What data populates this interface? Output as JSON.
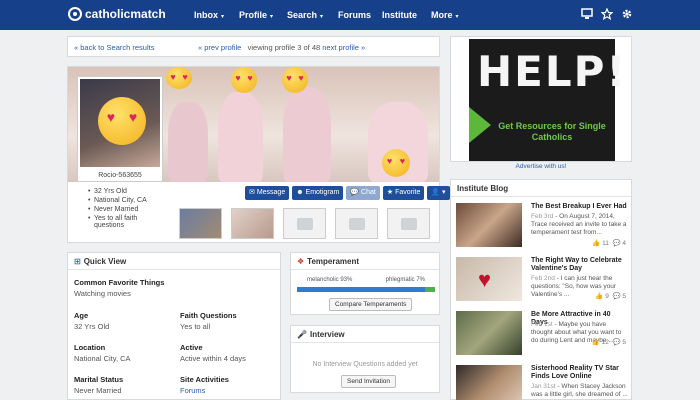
{
  "nav": {
    "logo": "catholicmatch",
    "items": [
      "Inbox",
      "Profile",
      "Search",
      "Forums",
      "Institute",
      "More"
    ],
    "caret": "▾",
    "icons": [
      "monitor-icon",
      "star-icon",
      "gear-icon"
    ]
  },
  "pager": {
    "back": "« back to Search results",
    "prev": "« prev profile",
    "viewing": "viewing profile 3 of 48",
    "next": "next profile »"
  },
  "profile": {
    "username": "Rocio-563655",
    "details": [
      "32 Yrs Old",
      "National City, CA",
      "Never Married",
      "Yes to all faith questions"
    ],
    "buttons": [
      "Message",
      "Emotigram",
      "Chat",
      "Favorite",
      "▾"
    ]
  },
  "quick_view": {
    "title": "Quick View",
    "common_label": "Common Favorite Things",
    "common_value": "Watching movies",
    "age_label": "Age",
    "age_value": "32 Yrs Old",
    "faith_label": "Faith Questions",
    "faith_value": "Yes to all",
    "location_label": "Location",
    "location_value": "National City, CA",
    "active_label": "Active",
    "active_value": "Active within 4 days",
    "marital_label": "Marital Status",
    "marital_value": "Never Married",
    "activities_label": "Site Activities",
    "activities_value": "Forums"
  },
  "temperament": {
    "title": "Temperament",
    "left_label": "melancholic 93%",
    "right_label": "phlegmatic 7%",
    "phlegmatic_fraction": 0.07,
    "button": "Compare Temperaments"
  },
  "interview": {
    "title": "Interview",
    "note": "No Interview Questions added yet",
    "button": "Send Invitation"
  },
  "ad": {
    "headline": "HELP!",
    "sub": "Get Resources for Single Catholics",
    "advertise": "Advertise with us!"
  },
  "blog": {
    "title": "Institute Blog",
    "posts": [
      {
        "title": "The Best Breakup I Ever Had",
        "date": "Feb 3rd",
        "text": " - On August 7, 2014, Trace received an invite to take a temperament test from...",
        "likes": "11",
        "comments": "4"
      },
      {
        "title": "The Right Way to Celebrate Valentine's Day",
        "date": "Feb 2nd",
        "text": " - I can just hear the questions: \"So, how was your Valentine's ...",
        "likes": "9",
        "comments": "5"
      },
      {
        "title": "Be More Attractive in 40 Days",
        "date": "Feb 1st",
        "text": " - Maybe you have thought about what you want to do during Lent and maybe ...",
        "likes": "12",
        "comments": "5"
      },
      {
        "title": "Sisterhood Reality TV Star Finds Love Online",
        "date": "Jan 31st",
        "text": " - When Stacey Jackson was a little girl, she dreamed of ...",
        "likes": "",
        "comments": ""
      }
    ]
  }
}
